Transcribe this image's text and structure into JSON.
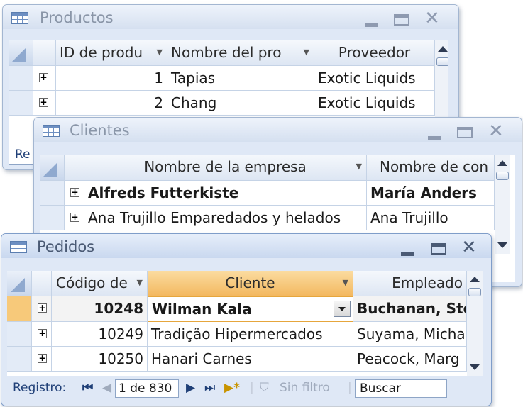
{
  "productos": {
    "title": "Productos",
    "columns": [
      "ID de produ",
      "Nombre del pro",
      "Proveedor"
    ],
    "rows": [
      {
        "id": "1",
        "nombre": "Tapias",
        "proveedor": "Exotic Liquids"
      },
      {
        "id": "2",
        "nombre": "Chang",
        "proveedor": "Exotic Liquids"
      }
    ],
    "nav_partial": "Re"
  },
  "clientes": {
    "title": "Clientes",
    "columns": [
      "Nombre de la empresa",
      "Nombre de con"
    ],
    "rows": [
      {
        "empresa": "Alfreds Futterkiste",
        "contacto": "María Anders"
      },
      {
        "empresa": "Ana Trujillo Emparedados y helados",
        "contacto": "Ana Trujillo"
      }
    ]
  },
  "pedidos": {
    "title": "Pedidos",
    "columns": [
      "Código de",
      "Cliente",
      "Empleado"
    ],
    "rows": [
      {
        "codigo": "10248",
        "cliente": "Wilman Kala",
        "empleado": "Buchanan, Ste"
      },
      {
        "codigo": "10249",
        "cliente": "Tradição Hipermercados",
        "empleado": "Suyama, Micha"
      },
      {
        "codigo": "10250",
        "cliente": "Hanari Carnes",
        "empleado": "Peacock, Marg"
      }
    ],
    "nav": {
      "label": "Registro:",
      "position": "1 de 830",
      "filter": "Sin filtro",
      "search": "Buscar"
    }
  },
  "icons": {
    "first": "first-record-icon",
    "prev": "previous-record-icon",
    "next": "next-record-icon",
    "last": "last-record-icon",
    "new": "new-record-icon",
    "filter": "filter-icon"
  }
}
